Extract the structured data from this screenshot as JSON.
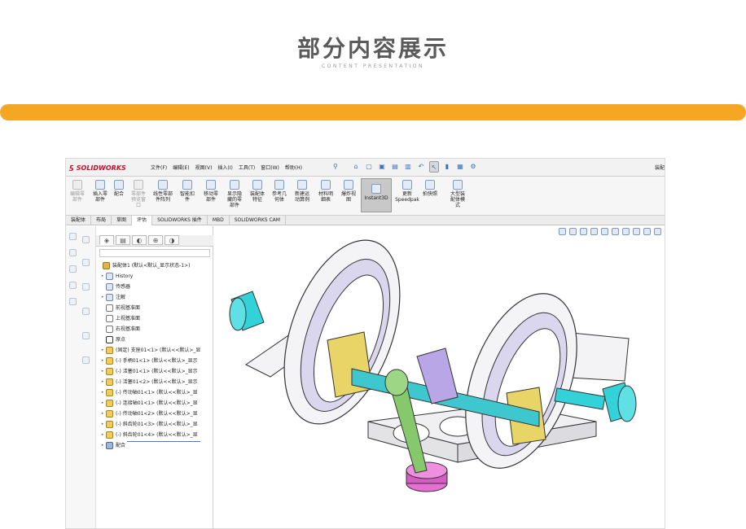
{
  "page": {
    "title": "部分内容展示",
    "subtitle": "CONTENT PRESENTATION"
  },
  "app": {
    "logo_text": "SOLIDWORKS",
    "menu": [
      "文件(F)",
      "编辑(E)",
      "视图(V)",
      "插入(I)",
      "工具(T)",
      "窗口(W)",
      "帮助(H)"
    ],
    "top_right": "装配"
  },
  "ribbon": [
    {
      "label": "编辑零\n部件",
      "disabled": true
    },
    {
      "label": "插入零\n部件",
      "disabled": false
    },
    {
      "label": "配合",
      "disabled": false
    },
    {
      "label": "零部件\n预览窗\n口",
      "disabled": true
    },
    {
      "label": "线性零部\n件阵列",
      "disabled": false
    },
    {
      "label": "智能扣\n件",
      "disabled": false
    },
    {
      "label": "移动零\n部件",
      "disabled": false
    },
    {
      "label": "显示隐\n藏的零\n部件",
      "disabled": false
    },
    {
      "label": "装配体\n特征",
      "disabled": false
    },
    {
      "label": "参考几\n何体",
      "disabled": false
    },
    {
      "label": "新建运\n动算例",
      "disabled": false
    },
    {
      "label": "材料明\n细表",
      "disabled": false
    },
    {
      "label": "爆炸视\n图",
      "disabled": false
    },
    {
      "label": "Instant3D",
      "disabled": false,
      "selected": true
    },
    {
      "label": "更新\nSpeedpak",
      "disabled": false
    },
    {
      "label": "拍快照",
      "disabled": false
    },
    {
      "label": "大型装\n配体模\n式",
      "disabled": false
    }
  ],
  "tabs": [
    "装配体",
    "布局",
    "草图",
    "评估",
    "SOLIDWORKS 插件",
    "MBD",
    "SOLIDWORKS CAM"
  ],
  "active_tab": "评估",
  "tree": [
    {
      "label": "装配体1 (默认<默认_显示状态-1>)",
      "icon": "asm",
      "indent": 0,
      "expander": ""
    },
    {
      "label": "History",
      "icon": "hist",
      "indent": 1,
      "expander": "▸"
    },
    {
      "label": "传感器",
      "icon": "hist",
      "indent": 1,
      "expander": ""
    },
    {
      "label": "注解",
      "icon": "hist",
      "indent": 1,
      "expander": "▸"
    },
    {
      "label": "前视基准面",
      "icon": "plane",
      "indent": 1,
      "expander": ""
    },
    {
      "label": "上视基准面",
      "icon": "plane",
      "indent": 1,
      "expander": ""
    },
    {
      "label": "右视基准面",
      "icon": "plane",
      "indent": 1,
      "expander": ""
    },
    {
      "label": "原点",
      "icon": "orig",
      "indent": 1,
      "expander": ""
    },
    {
      "label": "(固定) 支座01<1> (默认<<默认>_显",
      "icon": "part",
      "indent": 1,
      "expander": "▸"
    },
    {
      "label": "(-) 手柄01<1> (默认<<默认>_显示",
      "icon": "part",
      "indent": 1,
      "expander": "▸"
    },
    {
      "label": "(-) 活塞01<1> (默认<<默认>_显示",
      "icon": "part",
      "indent": 1,
      "expander": "▸"
    },
    {
      "label": "(-) 活塞01<2> (默认<<默认>_显示",
      "icon": "part",
      "indent": 1,
      "expander": "▸"
    },
    {
      "label": "(-) 传动轴01<1> (默认<<默认>_显",
      "icon": "part",
      "indent": 1,
      "expander": "▸"
    },
    {
      "label": "(-) 连接轴01<1> (默认<<默认>_显",
      "icon": "part",
      "indent": 1,
      "expander": "▸"
    },
    {
      "label": "(-) 传动轴01<2> (默认<<默认>_显",
      "icon": "part",
      "indent": 1,
      "expander": "▸"
    },
    {
      "label": "(-) 斜齿轮01<3> (默认<<默认>_显",
      "icon": "part",
      "indent": 1,
      "expander": "▸"
    },
    {
      "label": "(-) 斜齿轮01<4> (默认<<默认>_显",
      "icon": "part",
      "indent": 1,
      "expander": "▸"
    },
    {
      "label": "配合",
      "icon": "mate",
      "indent": 1,
      "expander": "▸"
    }
  ],
  "colors": {
    "accent_bar": "#f5a623",
    "title": "#5a5a5a",
    "logo": "#c8102e",
    "model_cyan": "#33d2d8",
    "model_gear": "#e8d467",
    "model_cage": "#d9d6ee",
    "model_frame": "#f0f0f2",
    "model_purple": "#b9a6e6",
    "model_green": "#86c96c",
    "model_magenta": "#e56fd3"
  }
}
